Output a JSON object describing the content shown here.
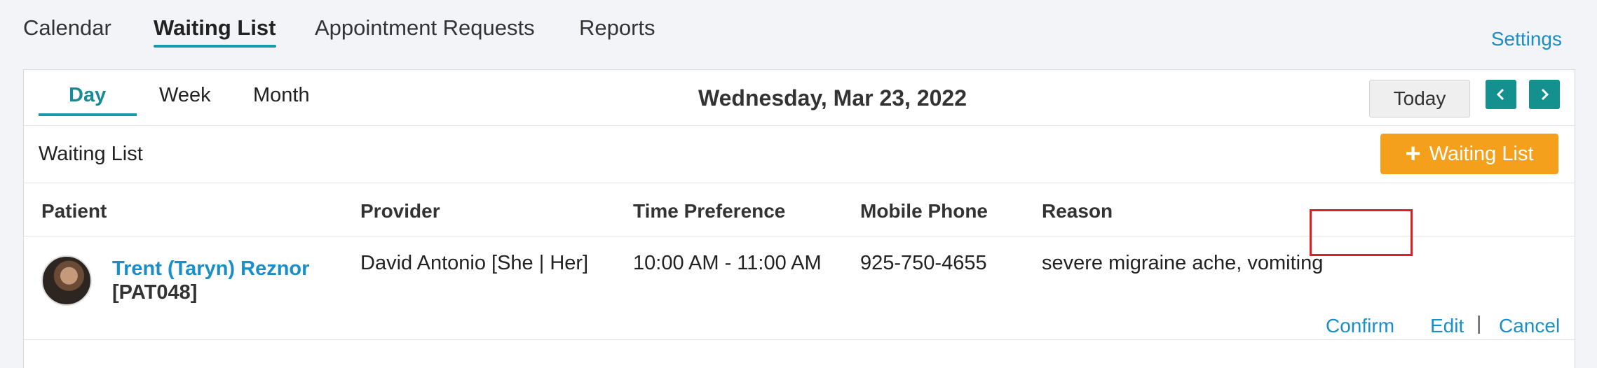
{
  "topnav": {
    "tabs": [
      {
        "label": "Calendar"
      },
      {
        "label": "Waiting List"
      },
      {
        "label": "Appointment Requests"
      },
      {
        "label": "Reports"
      }
    ],
    "settings_label": "Settings"
  },
  "subnav": {
    "tabs": [
      {
        "label": "Day"
      },
      {
        "label": "Week"
      },
      {
        "label": "Month"
      }
    ],
    "date_title": "Wednesday, Mar 23, 2022",
    "today_label": "Today",
    "prev_icon": "chevron-left-icon",
    "next_icon": "chevron-right-icon"
  },
  "waiting_list": {
    "title": "Waiting List",
    "add_button_label": "Waiting List",
    "add_icon": "plus-icon",
    "columns": [
      "Patient",
      "Provider",
      "Time Preference",
      "Mobile Phone",
      "Reason"
    ],
    "rows": [
      {
        "patient_name": "Trent (Taryn) Reznor",
        "patient_id": "[PAT048]",
        "provider": "David Antonio [She | Her]",
        "time_preference": "10:00 AM - 11:00 AM",
        "mobile_phone": "925-750-4655",
        "reason": "severe migraine ache, vomiting",
        "actions": {
          "confirm": "Confirm",
          "edit": "Edit",
          "separator": "|",
          "cancel": "Cancel"
        }
      }
    ]
  },
  "colors": {
    "accent": "#1a9aa8",
    "link": "#1a8ec8",
    "add_button": "#f4a01c",
    "highlight": "#e02020"
  }
}
